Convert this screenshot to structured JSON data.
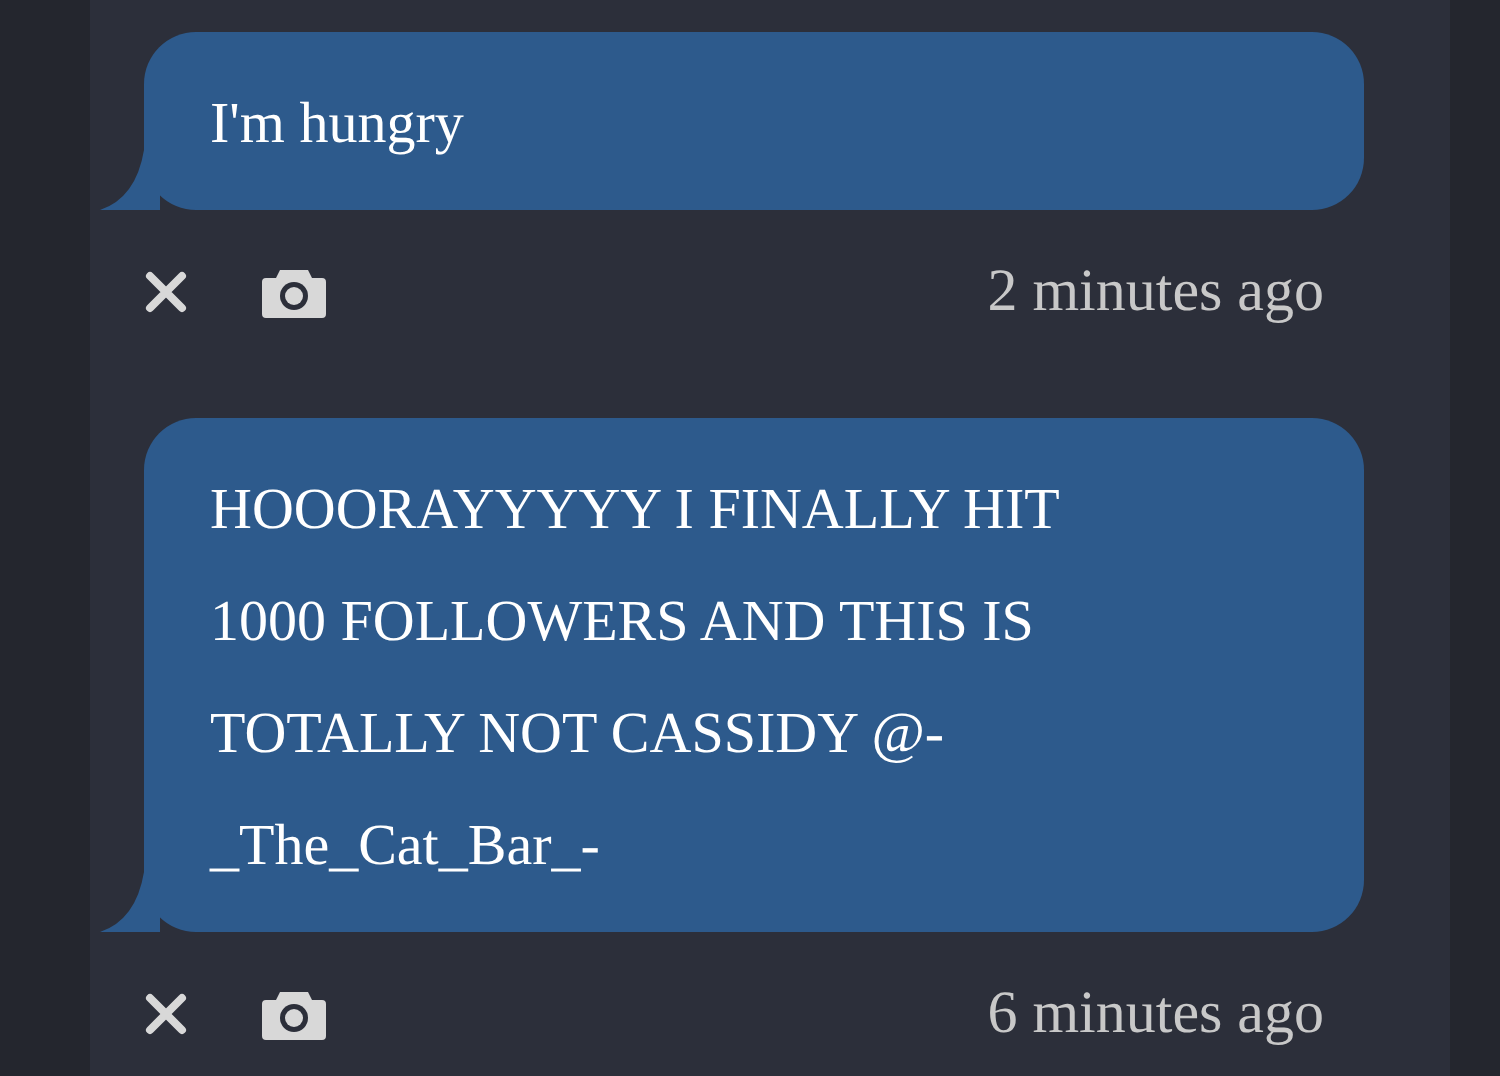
{
  "messages": [
    {
      "text": "I'm hungry",
      "time": "2 minutes ago"
    },
    {
      "text": "HOOORAYYYYY I FINALLY HIT 1000 FOLLOWERS AND THIS IS TOTALLY NOT CASSIDY @-_The_Cat_Bar_-",
      "time": "6 minutes ago"
    }
  ]
}
